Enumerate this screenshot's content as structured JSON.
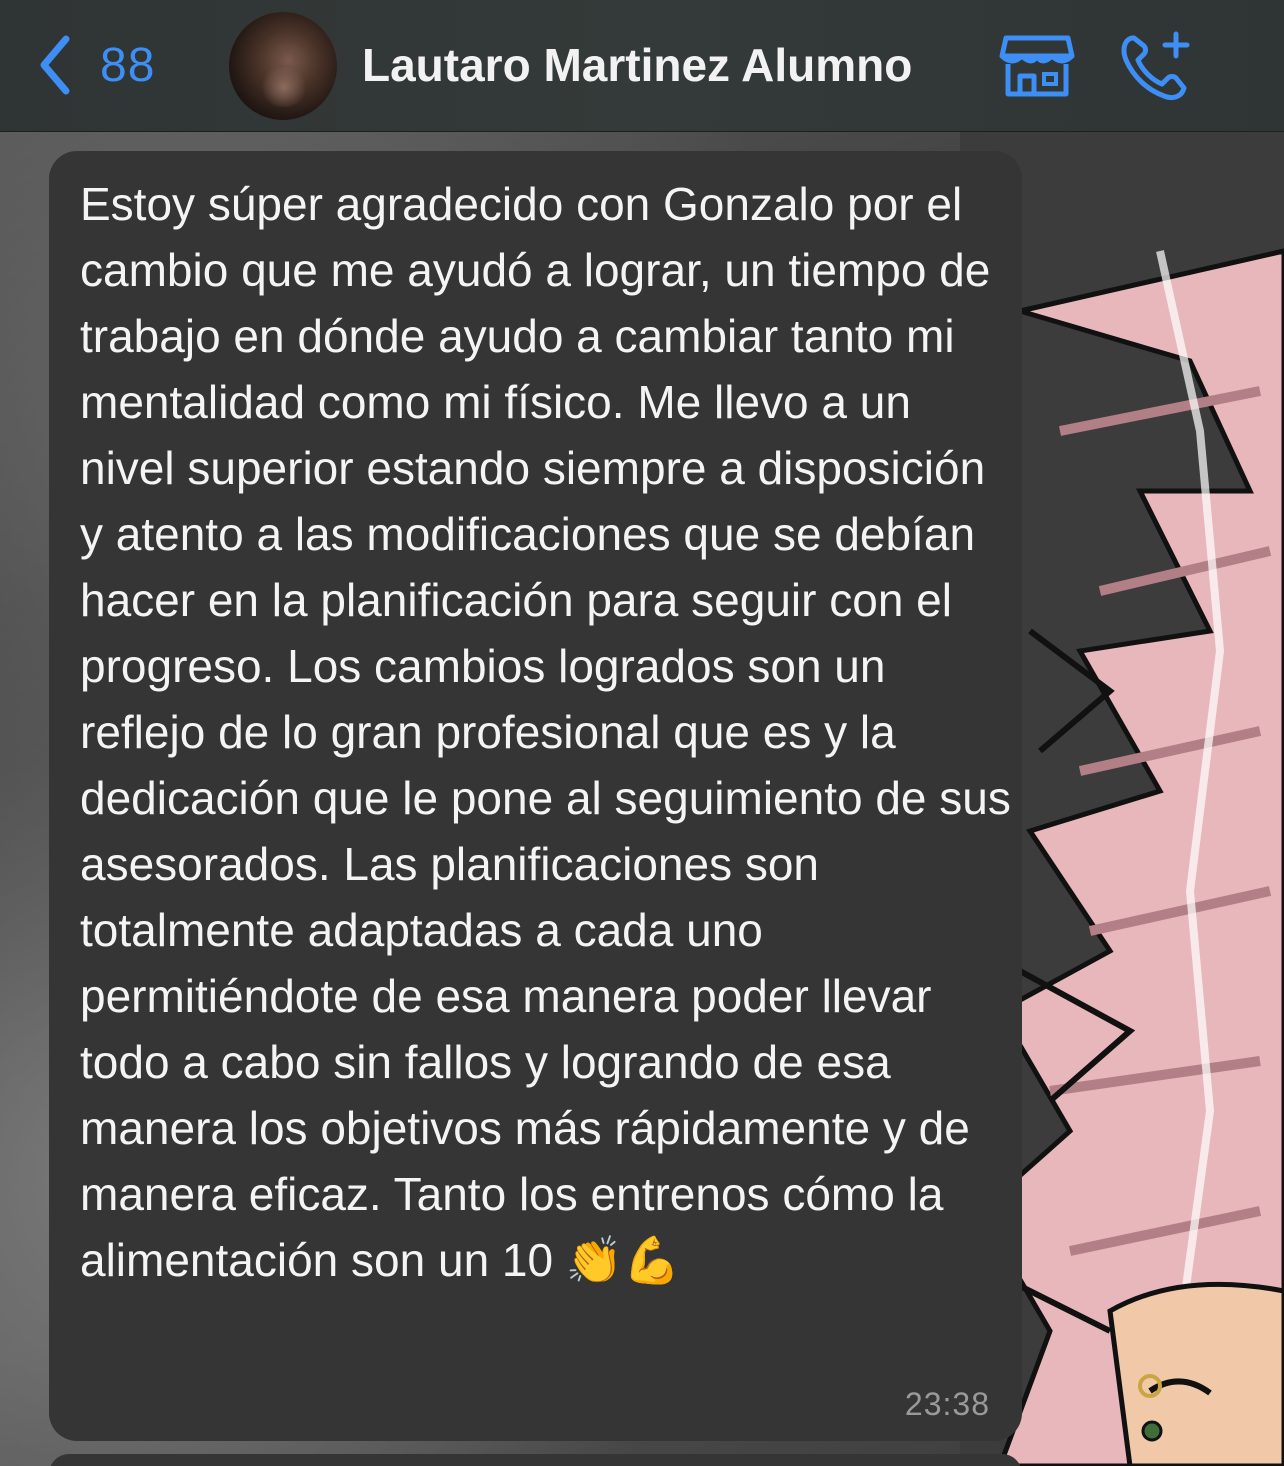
{
  "header": {
    "back_count": "88",
    "contact_name": "Lautaro Martinez Alumno",
    "icons": [
      "chevron-left-icon",
      "store-icon",
      "add-call-icon"
    ],
    "accent_color": "#3d8ef5"
  },
  "message": {
    "text": "Estoy súper agradecido con Gonzalo por el cambio que me ayudó a lograr, un tiempo de trabajo en dónde ayudo a cambiar tanto mi mentalidad como mi físico. Me llevo a un nivel superior estando siempre a disposición y atento a las modificaciones que se debían hacer en la planificación para seguir con el progreso. Los cambios logrados son un reflejo de lo gran profesional que es y la dedicación que le pone al seguimiento de sus asesorados. Las planificaciones son totalmente adaptadas a cada uno permitiéndote de esa manera poder llevar todo a cabo sin fallos y logrando de esa manera los objetivos más rápidamente y de manera eficaz. Tanto los entrenos cómo la alimentación son un 10 👏💪",
    "time": "23:38",
    "bubble_color": "#353535"
  }
}
